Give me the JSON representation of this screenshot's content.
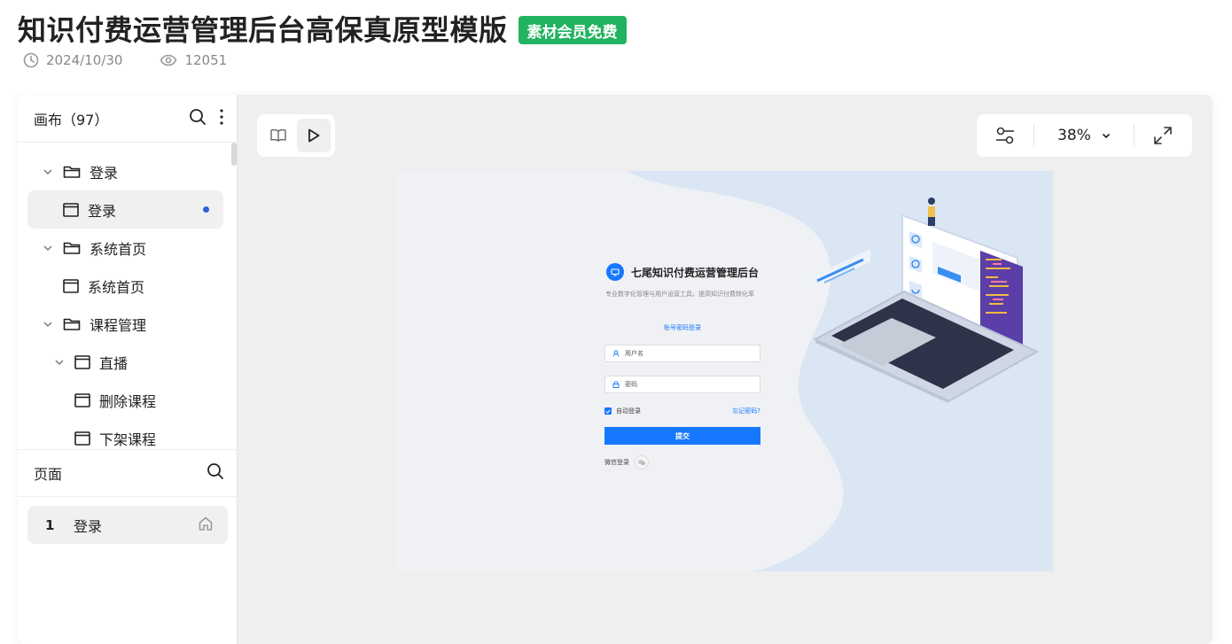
{
  "header": {
    "title": "知识付费运营管理后台高保真原型模版",
    "badge": "素材会员免费",
    "date": "2024/10/30",
    "views": "12051"
  },
  "canvas_panel": {
    "title": "画布（97）",
    "tree": [
      {
        "label": "登录",
        "type": "folder",
        "level": 0,
        "expanded": true
      },
      {
        "label": "登录",
        "type": "page",
        "level": 1,
        "active": true
      },
      {
        "label": "系统首页",
        "type": "folder",
        "level": 0,
        "expanded": true
      },
      {
        "label": "系统首页",
        "type": "page",
        "level": 1
      },
      {
        "label": "课程管理",
        "type": "folder",
        "level": 0,
        "expanded": true
      },
      {
        "label": "直播",
        "type": "page",
        "level": 1,
        "expanded": true
      },
      {
        "label": "删除课程",
        "type": "page",
        "level": 2
      },
      {
        "label": "下架课程",
        "type": "page",
        "level": 2
      }
    ]
  },
  "pages_panel": {
    "title": "页面",
    "items": [
      {
        "num": "1",
        "label": "登录",
        "icon": "home-icon"
      }
    ]
  },
  "toolbar": {
    "zoom": "38%",
    "icons": [
      "book-icon",
      "play-icon",
      "sliders-icon",
      "chevron-down-icon",
      "expand-icon"
    ]
  },
  "preview": {
    "brand": "七尾知识付费运营管理后台",
    "subtitle": "专业数字化管理与用户运营工具，提高知识付费转化率",
    "login_tab": "账号密码登录",
    "username_placeholder": "用户名",
    "password_placeholder": "密码",
    "remember": "自动登录",
    "forgot": "忘记密码?",
    "submit": "提交",
    "wechat": "微信登录"
  },
  "colors": {
    "accent": "#1677ff",
    "badge": "#21b35f",
    "active_dot": "#2a63d4",
    "canvas_bg": "#efeff0",
    "artboard_blue": "#dbe6f4"
  }
}
